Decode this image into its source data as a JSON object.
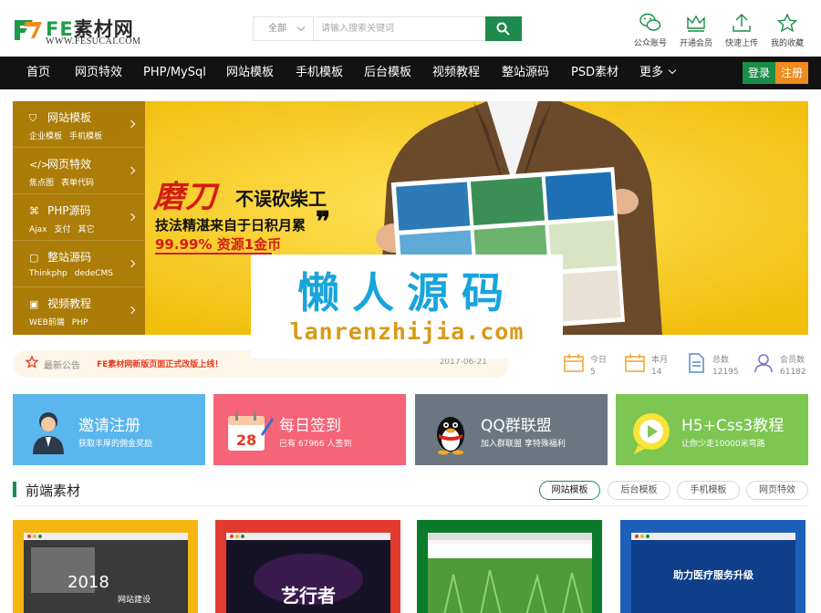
{
  "header": {
    "logo_fe": "FE",
    "logo_name": "素材网",
    "logo_url": "WWW.FESUCAI.COM",
    "search_category": "全部",
    "search_placeholder": "请输入搜索关键词",
    "tools": [
      {
        "label": "公众账号",
        "icon": "wechat-icon"
      },
      {
        "label": "开通会员",
        "icon": "crown-icon"
      },
      {
        "label": "快速上传",
        "icon": "upload-icon"
      },
      {
        "label": "我的收藏",
        "icon": "star-icon"
      }
    ]
  },
  "nav": {
    "items": [
      "首页",
      "网页特效",
      "PHP/MySql",
      "网站模板",
      "手机模板",
      "后台模板",
      "视频教程",
      "整站源码",
      "PSD素材",
      "更多"
    ],
    "login": "登录",
    "register": "注册"
  },
  "sidemenu": [
    {
      "title": "网站模板",
      "icon": "shield-icon",
      "links": [
        "企业模板",
        "手机模板"
      ]
    },
    {
      "title": "网页特效",
      "icon": "code-icon",
      "links": [
        "焦点图",
        "表单代码"
      ]
    },
    {
      "title": "PHP源码",
      "icon": "php-icon",
      "links": [
        "Ajax",
        "支付",
        "其它"
      ]
    },
    {
      "title": "整站源码",
      "icon": "file-icon",
      "links": [
        "Thinkphp",
        "dedeCMS"
      ]
    },
    {
      "title": "视频教程",
      "icon": "video-icon",
      "links": [
        "WEB前端",
        "PHP"
      ]
    }
  ],
  "banner": {
    "slogan_main": "磨刀",
    "slogan_sub": "不误砍柴工",
    "slogan_line2": "技法精湛来自于日积月累",
    "slogan_line3": "99.99% 资源1金币",
    "quote_mark": "❞",
    "accent_color": "#f7cb15"
  },
  "watermark": {
    "title": "懒人源码",
    "url": "lanrenzhijia.com"
  },
  "notice": {
    "label": "最新公告",
    "text": "FE素材网新版页面正式改版上线！",
    "date": "2017-06-21"
  },
  "stats": [
    {
      "label": "今日",
      "value": "5",
      "icon": "calendar-today-icon"
    },
    {
      "label": "本月",
      "value": "14",
      "icon": "calendar-month-icon"
    },
    {
      "label": "总数",
      "value": "12195",
      "icon": "document-icon"
    },
    {
      "label": "会员数",
      "value": "61182",
      "icon": "users-icon"
    }
  ],
  "cards": [
    {
      "title": "邀请注册",
      "sub": "获取丰厚的佣金奖励",
      "color": "#5bb6ee",
      "icon": "person-icon"
    },
    {
      "title": "每日签到",
      "sub": "已有 67966 人签到",
      "color": "#f56478",
      "icon": "calendar-pen-icon",
      "badge": "28"
    },
    {
      "title": "QQ群联盟",
      "sub": "加入群联盟 享特殊福利",
      "color": "#6b7780",
      "icon": "qq-penguin-icon"
    },
    {
      "title": "H5+Css3教程",
      "sub": "让你少走10000米弯路",
      "color": "#7dc652",
      "icon": "play-bubble-icon"
    }
  ],
  "section": {
    "title": "前端素材",
    "tabs": [
      "网站模板",
      "后台模板",
      "手机模板",
      "网页特效"
    ],
    "active_tab": 0
  },
  "thumbs": [
    {
      "bg": "#f6b511",
      "label": "2018",
      "sub": "网站建设"
    },
    {
      "bg": "#e23b2d",
      "label": "艺行者"
    },
    {
      "bg": "#0b7a2b"
    },
    {
      "bg": "#1c5fb8",
      "label": "助力医疗服务升级"
    }
  ]
}
